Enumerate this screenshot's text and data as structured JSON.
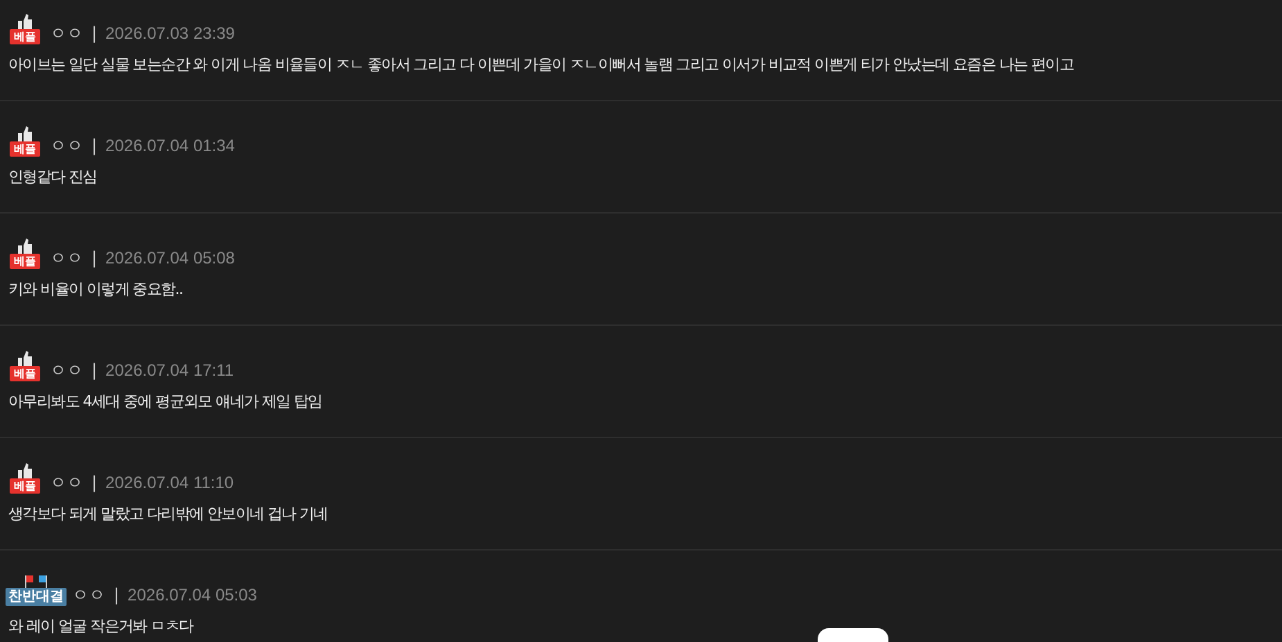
{
  "comments": [
    {
      "badge": {
        "kind": "best",
        "label": "베플"
      },
      "author": "ㅇㅇ",
      "separator": "|",
      "date": "2026.07.03 23:39",
      "text": "아이브는 일단 실물 보는순간 와 이게 나옴 비율들이 ㅈㄴ 좋아서 그리고 다 이쁜데 가을이 ㅈㄴ이뻐서 놀램 그리고 이서가 비교적 이쁜게 티가 안났는데 요즘은 나는 편이고"
    },
    {
      "badge": {
        "kind": "best",
        "label": "베플"
      },
      "author": "ㅇㅇ",
      "separator": "|",
      "date": "2026.07.04 01:34",
      "text": "인형같다 진심"
    },
    {
      "badge": {
        "kind": "best",
        "label": "베플"
      },
      "author": "ㅇㅇ",
      "separator": "|",
      "date": "2026.07.04 05:08",
      "text": "키와 비율이 이렇게 중요함.."
    },
    {
      "badge": {
        "kind": "best",
        "label": "베플"
      },
      "author": "ㅇㅇ",
      "separator": "|",
      "date": "2026.07.04 17:11",
      "text": "아무리봐도 4세대 중에 평균외모 얘네가 제일 탑임"
    },
    {
      "badge": {
        "kind": "best",
        "label": "베플"
      },
      "author": "ㅇㅇ",
      "separator": "|",
      "date": "2026.07.04 11:10",
      "text": "생각보다 되게 말랐고 다리밖에 안보이네 겁나 기네"
    },
    {
      "badge": {
        "kind": "debate",
        "label": "찬반대결"
      },
      "author": "ㅇㅇ",
      "separator": "|",
      "date": "2026.07.04 05:03",
      "text": "와 레이 얼굴 작은거봐 ㅁㅊ다"
    }
  ]
}
